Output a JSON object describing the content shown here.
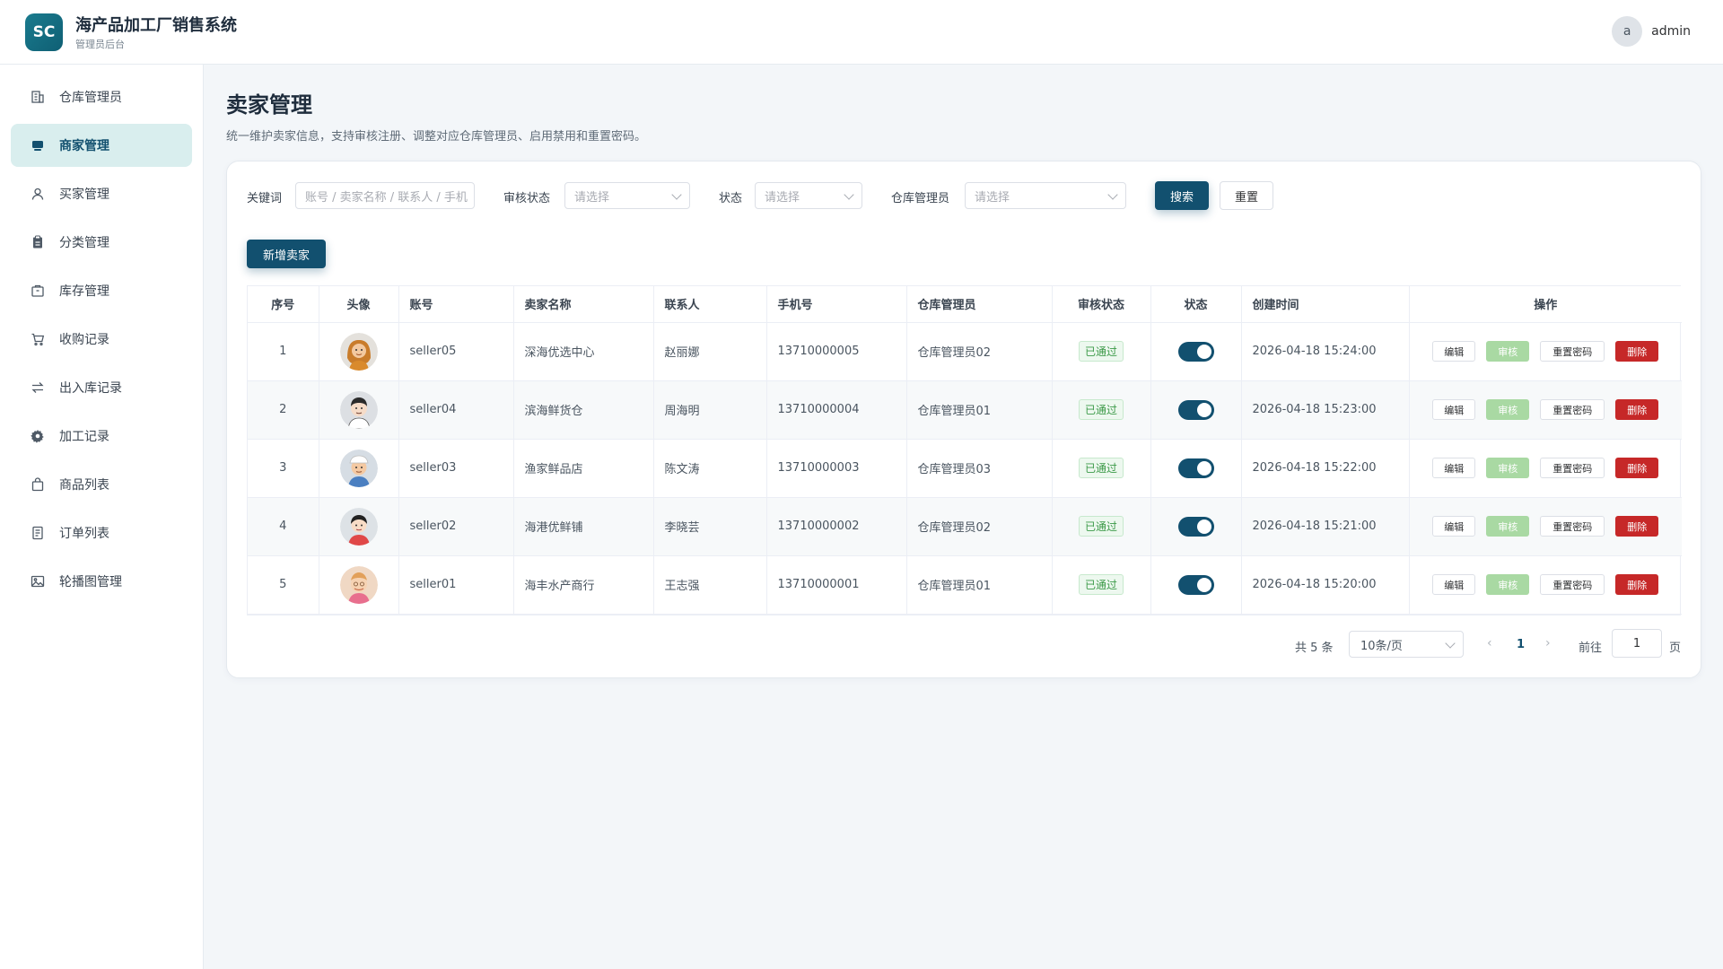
{
  "header": {
    "logo_text": "SC",
    "app_title": "海产品加工厂销售系统",
    "app_subtitle": "管理员后台",
    "user_initial": "a",
    "user_name": "admin"
  },
  "sidebar": {
    "items": [
      {
        "label": "仓库管理员",
        "icon": "building-icon",
        "active": false
      },
      {
        "label": "商家管理",
        "icon": "shop-icon",
        "active": true
      },
      {
        "label": "买家管理",
        "icon": "user-icon",
        "active": false
      },
      {
        "label": "分类管理",
        "icon": "clipboard-icon",
        "active": false
      },
      {
        "label": "库存管理",
        "icon": "box-icon",
        "active": false
      },
      {
        "label": "收购记录",
        "icon": "cart-icon",
        "active": false
      },
      {
        "label": "出入库记录",
        "icon": "transfer-icon",
        "active": false
      },
      {
        "label": "加工记录",
        "icon": "gear-icon",
        "active": false
      },
      {
        "label": "商品列表",
        "icon": "bag-icon",
        "active": false
      },
      {
        "label": "订单列表",
        "icon": "document-icon",
        "active": false
      },
      {
        "label": "轮播图管理",
        "icon": "image-icon",
        "active": false
      }
    ]
  },
  "page": {
    "title": "卖家管理",
    "description": "统一维护卖家信息，支持审核注册、调整对应仓库管理员、启用禁用和重置密码。"
  },
  "filters": {
    "keyword_label": "关键词",
    "keyword_placeholder": "账号 / 卖家名称 / 联系人 / 手机",
    "audit_label": "审核状态",
    "audit_placeholder": "请选择",
    "status_label": "状态",
    "status_placeholder": "请选择",
    "warehouse_label": "仓库管理员",
    "warehouse_placeholder": "请选择",
    "search_button": "搜索",
    "reset_button": "重置"
  },
  "add_button": "新增卖家",
  "table": {
    "columns": [
      "序号",
      "头像",
      "账号",
      "卖家名称",
      "联系人",
      "手机号",
      "仓库管理员",
      "审核状态",
      "状态",
      "创建时间",
      "操作"
    ],
    "rows": [
      {
        "index": "1",
        "account": "seller05",
        "name": "深海优选中心",
        "contact": "赵丽娜",
        "phone": "13710000005",
        "warehouse": "仓库管理员02",
        "audit": "已通过",
        "enabled": true,
        "created": "2026-04-18 15:24:00"
      },
      {
        "index": "2",
        "account": "seller04",
        "name": "滨海鲜货仓",
        "contact": "周海明",
        "phone": "13710000004",
        "warehouse": "仓库管理员01",
        "audit": "已通过",
        "enabled": true,
        "created": "2026-04-18 15:23:00"
      },
      {
        "index": "3",
        "account": "seller03",
        "name": "渔家鲜品店",
        "contact": "陈文涛",
        "phone": "13710000003",
        "warehouse": "仓库管理员03",
        "audit": "已通过",
        "enabled": true,
        "created": "2026-04-18 15:22:00"
      },
      {
        "index": "4",
        "account": "seller02",
        "name": "海港优鲜铺",
        "contact": "李晓芸",
        "phone": "13710000002",
        "warehouse": "仓库管理员02",
        "audit": "已通过",
        "enabled": true,
        "created": "2026-04-18 15:21:00"
      },
      {
        "index": "5",
        "account": "seller01",
        "name": "海丰水产商行",
        "contact": "王志强",
        "phone": "13710000001",
        "warehouse": "仓库管理员01",
        "audit": "已通过",
        "enabled": true,
        "created": "2026-04-18 15:20:00"
      }
    ],
    "actions": {
      "edit": "编辑",
      "audit": "审核",
      "reset_password": "重置密码",
      "delete": "删除"
    }
  },
  "pagination": {
    "total": "共 5 条",
    "page_size": "10条/页",
    "current_page": "1",
    "goto_label": "前往",
    "goto_value": "1",
    "page_suffix": "页"
  },
  "colors": {
    "primary": "#12506f",
    "active_nav_bg": "#d9eeee",
    "audit_btn": "#a9d9a3",
    "delete_btn": "#c62828",
    "success_tag": "#3c9a48"
  }
}
